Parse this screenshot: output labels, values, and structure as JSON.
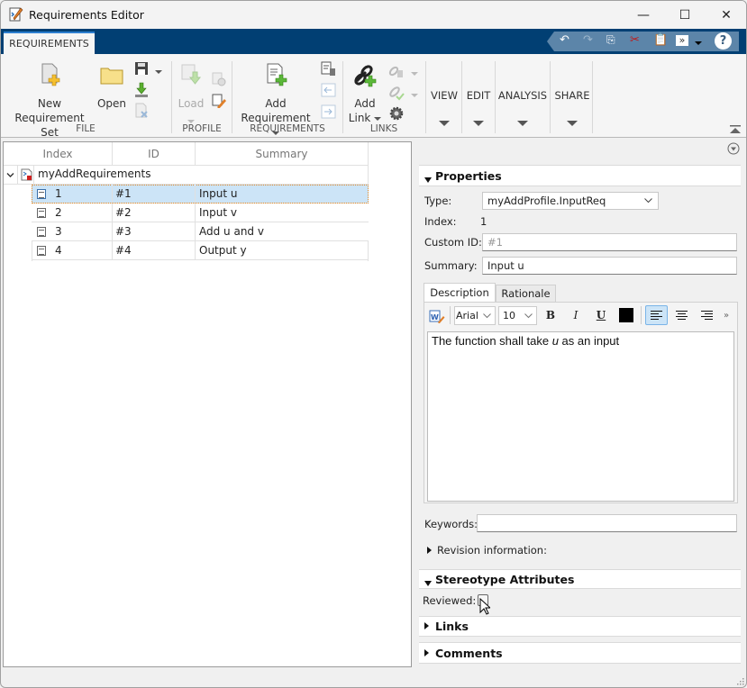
{
  "window": {
    "title": "Requirements Editor",
    "controls": {
      "minimize": "—",
      "maximize": "☐",
      "close": "✕"
    }
  },
  "tabs": [
    {
      "label": "REQUIREMENTS",
      "active": true
    }
  ],
  "quick_access": {
    "icons": [
      "undo-icon",
      "redo-icon",
      "copy-icon",
      "cut-icon",
      "paste-icon",
      "shortcut-icon",
      "dropdown-icon",
      "help-icon"
    ],
    "help": "?"
  },
  "ribbon": {
    "groups": [
      {
        "label": "FILE",
        "buttons": [
          {
            "label_line1": "New",
            "label_line2": "Requirement Set",
            "enabled": true
          },
          {
            "label_line1": "Open",
            "enabled": true
          },
          {
            "icon": "save-icon",
            "enabled": true
          },
          {
            "icon": "import-icon",
            "enabled": true
          },
          {
            "icon": "close-set-icon",
            "enabled": false
          }
        ]
      },
      {
        "label": "PROFILE",
        "buttons": [
          {
            "label_line1": "Load",
            "enabled": false
          },
          {
            "icon": "profile-settings-icon",
            "enabled": false
          },
          {
            "icon": "profile-edit-icon",
            "enabled": true
          }
        ]
      },
      {
        "label": "REQUIREMENTS",
        "buttons": [
          {
            "label_line1": "Add",
            "label_line2": "Requirement",
            "enabled": true
          },
          {
            "icon": "delete-requirement-icon",
            "enabled": true
          },
          {
            "icon": "promote-icon",
            "enabled": false
          },
          {
            "icon": "demote-icon",
            "enabled": false
          }
        ]
      },
      {
        "label": "LINKS",
        "buttons": [
          {
            "label_line1": "Add",
            "label_line2": "Link",
            "enabled": true
          },
          {
            "icon": "delete-link-icon",
            "enabled": false
          },
          {
            "icon": "validate-link-icon",
            "enabled": false
          },
          {
            "icon": "link-settings-icon",
            "enabled": true
          }
        ]
      },
      {
        "label": "VIEW"
      },
      {
        "label": "EDIT"
      },
      {
        "label": "ANALYSIS"
      },
      {
        "label": "SHARE"
      }
    ]
  },
  "tree": {
    "columns": [
      "Index",
      "ID",
      "Summary"
    ],
    "root": "myAddRequirements",
    "rows": [
      {
        "index": "1",
        "id": "#1",
        "summary": "Input u",
        "selected": true
      },
      {
        "index": "2",
        "id": "#2",
        "summary": "Input v",
        "selected": false
      },
      {
        "index": "3",
        "id": "#3",
        "summary": "Add u and v",
        "selected": false
      },
      {
        "index": "4",
        "id": "#4",
        "summary": "Output y",
        "selected": false
      }
    ]
  },
  "properties": {
    "title": "Properties",
    "type_label": "Type:",
    "type_value": "myAddProfile.InputReq",
    "index_label": "Index:",
    "index_value": "1",
    "custom_id_label": "Custom ID:",
    "custom_id_placeholder": "#1",
    "summary_label": "Summary:",
    "summary_value": "Input u",
    "desc_tabs": [
      "Description",
      "Rationale"
    ],
    "font_name": "Arial",
    "font_size": "10",
    "bold": "B",
    "italic": "I",
    "underline": "U",
    "more": "»",
    "description_before": "The function shall take ",
    "description_italic": "u",
    "description_after": " as an input",
    "keywords_label": "Keywords:",
    "keywords_value": "",
    "revision_label": "Revision information:"
  },
  "stereotype": {
    "title": "Stereotype Attributes",
    "reviewed_label": "Reviewed:",
    "reviewed_checked": false
  },
  "links": {
    "title": "Links"
  },
  "comments": {
    "title": "Comments"
  }
}
